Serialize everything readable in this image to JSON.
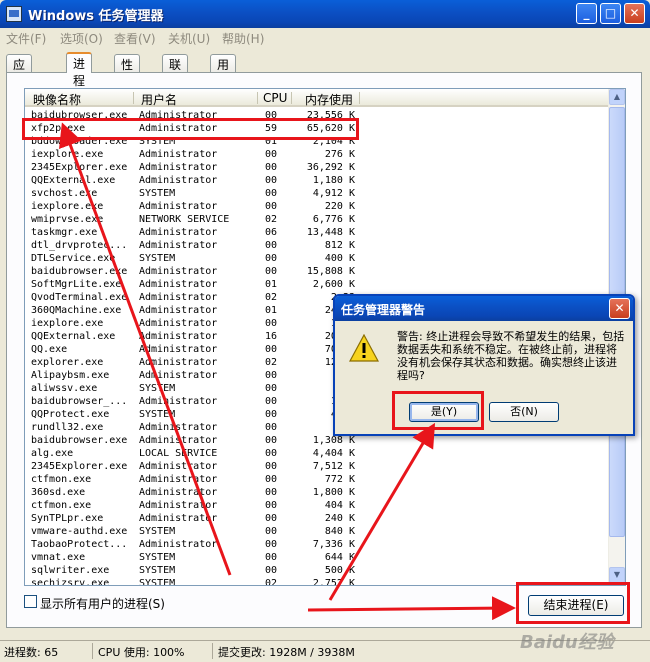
{
  "window": {
    "title": "Windows 任务管理器"
  },
  "menu": [
    "文件(F)",
    "选项(O)",
    "查看(V)",
    "关机(U)",
    "帮助(H)"
  ],
  "tabs": [
    "应用程序",
    "进程",
    "性能",
    "联网",
    "用户"
  ],
  "columns": [
    "映像名称",
    "用户名",
    "CPU",
    "内存使用"
  ],
  "processes": [
    [
      "baidubrowser.exe",
      "Administrator",
      "00",
      "23,556 K"
    ],
    [
      "xfp2p.exe",
      "Administrator",
      "59",
      "65,620 K"
    ],
    [
      "bddownloader.exe",
      "SYSTEM",
      "01",
      "2,104 K"
    ],
    [
      "iexplore.exe",
      "Administrator",
      "00",
      "276 K"
    ],
    [
      "2345Explorer.exe",
      "Administrator",
      "00",
      "36,292 K"
    ],
    [
      "QQExternal.exe",
      "Administrator",
      "00",
      "1,180 K"
    ],
    [
      "svchost.exe",
      "SYSTEM",
      "00",
      "4,912 K"
    ],
    [
      "iexplore.exe",
      "Administrator",
      "00",
      "220 K"
    ],
    [
      "wmiprvse.exe",
      "NETWORK SERVICE",
      "02",
      "6,776 K"
    ],
    [
      "taskmgr.exe",
      "Administrator",
      "06",
      "13,448 K"
    ],
    [
      "dtl_drvprotec...",
      "Administrator",
      "00",
      "812 K"
    ],
    [
      "DTLService.exe",
      "SYSTEM",
      "00",
      "400 K"
    ],
    [
      "baidubrowser.exe",
      "Administrator",
      "00",
      "15,808 K"
    ],
    [
      "SoftMgrLite.exe",
      "Administrator",
      "01",
      "2,600 K"
    ],
    [
      "QvodTerminal.exe",
      "Administrator",
      "02",
      "2,23"
    ],
    [
      "360QMachine.exe",
      "Administrator",
      "01",
      "24,20"
    ],
    [
      "iexplore.exe",
      "Administrator",
      "00",
      "1,30"
    ],
    [
      "QQExternal.exe",
      "Administrator",
      "16",
      "20,33"
    ],
    [
      "QQ.exe",
      "Administrator",
      "00",
      "70,26"
    ],
    [
      "explorer.exe",
      "Administrator",
      "02",
      "12,20"
    ],
    [
      "Alipaybsm.exe",
      "Administrator",
      "00",
      "40"
    ],
    [
      "aliwssv.exe",
      "SYSTEM",
      "00",
      "12"
    ],
    [
      "baidubrowser_...",
      "Administrator",
      "00",
      "1,49"
    ],
    [
      "QQProtect.exe",
      "SYSTEM",
      "00",
      "4,71"
    ],
    [
      "rundll32.exe",
      "Administrator",
      "00",
      "31"
    ],
    [
      "baidubrowser.exe",
      "Administrator",
      "00",
      "1,308 K"
    ],
    [
      "alg.exe",
      "LOCAL SERVICE",
      "00",
      "4,404 K"
    ],
    [
      "2345Explorer.exe",
      "Administrator",
      "00",
      "7,512 K"
    ],
    [
      "ctfmon.exe",
      "Administrator",
      "00",
      "772 K"
    ],
    [
      "360sd.exe",
      "Administrator",
      "00",
      "1,800 K"
    ],
    [
      "ctfmon.exe",
      "Administrator",
      "00",
      "404 K"
    ],
    [
      "SynTPLpr.exe",
      "Administrator",
      "00",
      "240 K"
    ],
    [
      "vmware-authd.exe",
      "SYSTEM",
      "00",
      "840 K"
    ],
    [
      "TaobaoProtect...",
      "Administrator",
      "00",
      "7,336 K"
    ],
    [
      "vmnat.exe",
      "SYSTEM",
      "00",
      "644 K"
    ],
    [
      "sqlwriter.exe",
      "SYSTEM",
      "00",
      "500 K"
    ],
    [
      "sechizsrv.exe",
      "SYSTEM",
      "02",
      "2,752 K"
    ]
  ],
  "show_all_users": "显示所有用户的进程(S)",
  "end_process_button": "结束进程(E)",
  "status": {
    "process_count": "进程数: 65",
    "cpu_usage": "CPU 使用: 100%",
    "commit_charge": "提交更改: 1928M / 3938M"
  },
  "dialog": {
    "title": "任务管理器警告",
    "message": "警告: 终止进程会导致不希望发生的结果，包括数据丢失和系统不稳定。在被终止前，进程将没有机会保存其状态和数据。确实想终止该进程吗?",
    "yes": "是(Y)",
    "no": "否(N)"
  },
  "watermark": "Baidu经验"
}
